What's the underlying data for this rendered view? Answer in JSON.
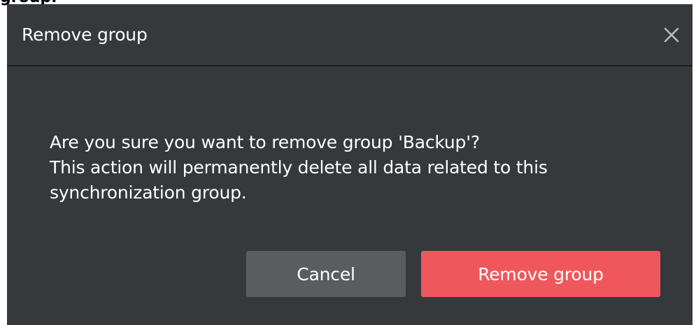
{
  "page": {
    "caption": "group."
  },
  "dialog": {
    "title": "Remove group",
    "message_line_1": "Are you sure you want to remove group 'Backup'?",
    "message_line_2": "This action will permanently delete all data related to this synchronization group.",
    "cancel_label": "Cancel",
    "remove_label": "Remove group",
    "close_icon": "close-icon"
  },
  "colors": {
    "dialog_background": "#36383c",
    "cancel_button": "#5a5c60",
    "remove_button": "#f0575d",
    "text": "#ffffff",
    "close_icon": "#b8babd"
  }
}
